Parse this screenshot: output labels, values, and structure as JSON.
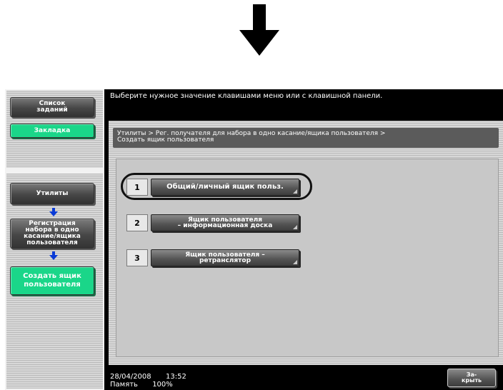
{
  "message": "Выберите нужное значение клавишами меню или с клавишной панели.",
  "sidebar": {
    "job_list": "Список\nзаданий",
    "bookmark": "Закладка",
    "utilities": "Утилиты",
    "registration": "Регистрация\nнабора в одно\nкасание/ящика\nпользователя",
    "create_box": "Создать ящик\nпользователя"
  },
  "breadcrumb": "Утилиты > Рег. получателя для набора в одно касание/ящика пользователя >\nСоздать ящик пользователя",
  "options": [
    {
      "number": "1",
      "label": "Общий/личный ящик польз."
    },
    {
      "number": "2",
      "label": "Ящик пользователя\n– информационная доска"
    },
    {
      "number": "3",
      "label": "Ящик пользователя –\nретранслятор"
    }
  ],
  "status": {
    "date": "28/04/2008",
    "time": "13:52",
    "memory_label": "Память",
    "memory_value": "100%"
  },
  "close_button": "За-\nкрыть"
}
